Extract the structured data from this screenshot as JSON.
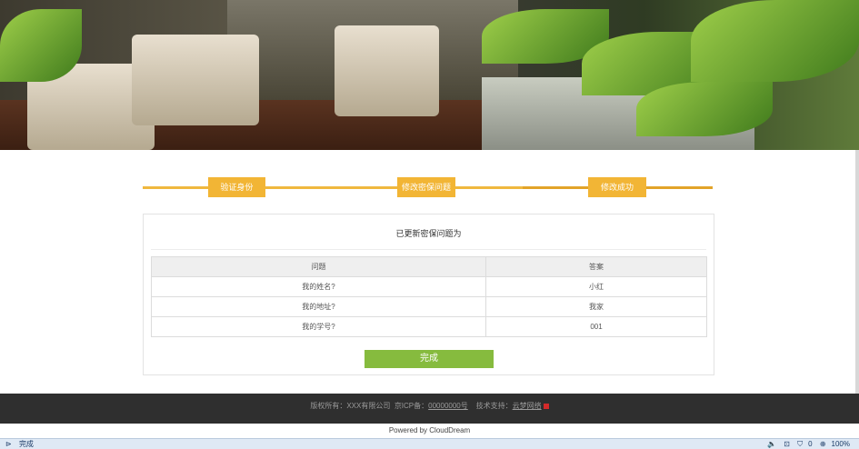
{
  "steps": [
    "验证身份",
    "修改密保问题",
    "修改成功"
  ],
  "result": {
    "title": "已更新密保问题为",
    "headers": [
      "问题",
      "答案"
    ],
    "rows": [
      [
        "我的姓名?",
        "小红"
      ],
      [
        "我的地址?",
        "我家"
      ],
      [
        "我的学号?",
        "001"
      ]
    ],
    "done_label": "完成"
  },
  "footer": {
    "copyright_prefix": "版权所有：XXX有限公司",
    "icp_prefix": "京ICP备：",
    "icp_link": "00000000号",
    "support_prefix": "技术支持：",
    "support_link": "云梦网络",
    "powered": "Powered by CloudDream"
  },
  "statusbar": {
    "status": "完成",
    "counter": "0",
    "zoom": "100%"
  },
  "colors": {
    "step_accent": "#f2b535",
    "button_green": "#86bb3e",
    "footer_bg": "#2f2f2f"
  }
}
